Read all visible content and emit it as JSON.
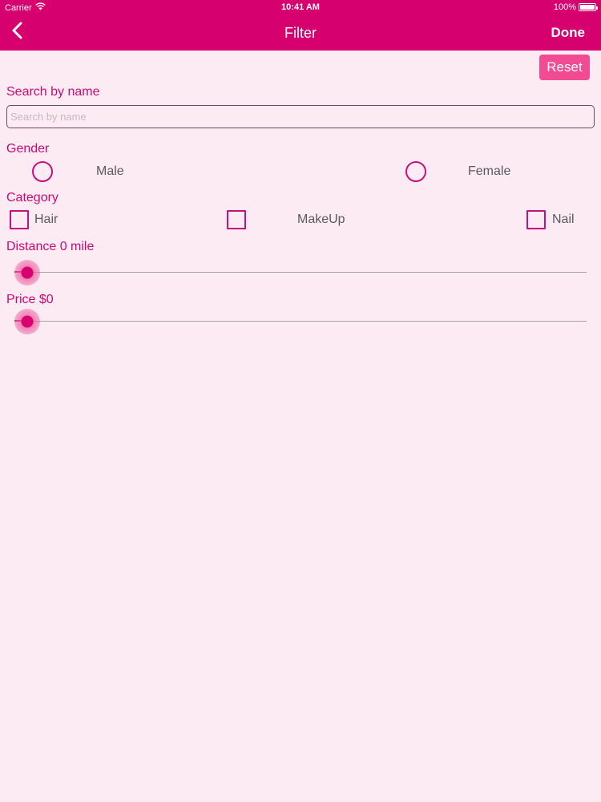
{
  "status_bar": {
    "carrier": "Carrier",
    "time": "10:41 AM",
    "battery": "100%"
  },
  "nav": {
    "back_icon": "chevron-left-icon",
    "title": "Filter",
    "done_label": "Done"
  },
  "reset_label": "Reset",
  "search": {
    "label": "Search by name",
    "placeholder": "Search by name",
    "value": ""
  },
  "gender": {
    "label": "Gender",
    "options": [
      {
        "label": "Male",
        "selected": false
      },
      {
        "label": "Female",
        "selected": false
      }
    ]
  },
  "category": {
    "label": "Category",
    "options": [
      {
        "label": "Hair",
        "checked": false
      },
      {
        "label": "MakeUp",
        "checked": false
      },
      {
        "label": "Nail",
        "checked": false
      }
    ]
  },
  "distance": {
    "label": "Distance 0 mile",
    "value_fraction": 0
  },
  "price": {
    "label": "Price $0",
    "value_fraction": 0
  },
  "colors": {
    "header": "#d6006e",
    "accent": "#c7117a",
    "reset_button": "#f24a93",
    "background": "#fdebf4"
  }
}
